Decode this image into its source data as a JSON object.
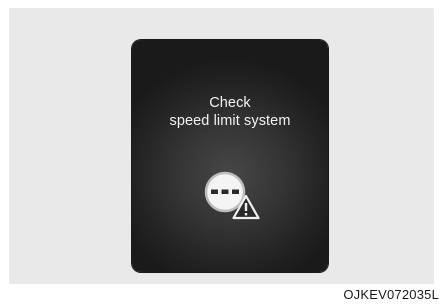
{
  "display": {
    "message_line1": "Check",
    "message_line2": "speed limit system",
    "icon": "speed-limit-unavailable-warning-icon"
  },
  "figure_code": "OJKEV072035L"
}
